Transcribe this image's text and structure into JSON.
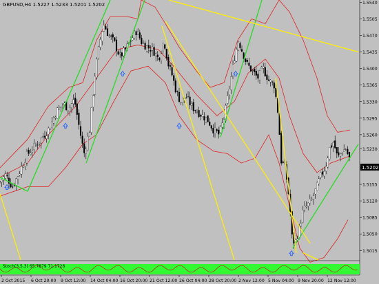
{
  "window": {
    "symbol_info": "GBPUSD,H4  1.5227 1.5233 1.5201 1.5202",
    "indicator_info": "Stoch(3,5,3) 65.7879 71.1726"
  },
  "price_axis": {
    "ticks": [
      "1.5540",
      "1.5505",
      "1.5470",
      "1.5435",
      "1.5400",
      "1.5365",
      "1.5330",
      "1.5295",
      "1.5260",
      "1.5230",
      "1.5190",
      "1.5155",
      "1.5120",
      "1.5085",
      "1.5050",
      "1.5015"
    ],
    "current_price": "1.5202",
    "range": [
      1.4995,
      1.5545
    ]
  },
  "time_axis": {
    "labels": [
      "2 Oct 2015",
      "6 Oct 20:00",
      "9 Oct 12:00",
      "14 Oct 04:00",
      "16 Oct 20:00",
      "21 Oct 12:00",
      "26 Oct 04:00",
      "28 Oct 20:00",
      "2 Nov 12:00",
      "5 Nov 04:00",
      "9 Nov 20:00",
      "12 Nov 12:00"
    ]
  },
  "colors": {
    "background": "#c0c0c0",
    "bull_candle": "#ffffff",
    "bear_candle": "#000000",
    "bollinger": "#e02020",
    "trendline_green": "#22dd22",
    "trendline_yellow": "#ffee00",
    "arrow": "#2060ff",
    "price_marker_bg": "#000000",
    "stoch_band": "#22ff22"
  },
  "icons": [
    "up-arrow-icon"
  ],
  "chart_data": {
    "type": "candlestick",
    "symbol": "GBPUSD",
    "timeframe": "H4",
    "ohlc_last": {
      "open": 1.5227,
      "high": 1.5233,
      "low": 1.5201,
      "close": 1.5202
    },
    "ylim": [
      1.4995,
      1.5545
    ],
    "close_path": [
      [
        0,
        1.516
      ],
      [
        8,
        1.5175
      ],
      [
        18,
        1.515
      ],
      [
        28,
        1.518
      ],
      [
        38,
        1.5215
      ],
      [
        50,
        1.5235
      ],
      [
        62,
        1.5255
      ],
      [
        72,
        1.5275
      ],
      [
        82,
        1.531
      ],
      [
        92,
        1.5325
      ],
      [
        100,
        1.5315
      ],
      [
        108,
        1.5335
      ],
      [
        115,
        1.5275
      ],
      [
        122,
        1.522
      ],
      [
        130,
        1.527
      ],
      [
        138,
        1.539
      ],
      [
        144,
        1.545
      ],
      [
        150,
        1.5495
      ],
      [
        158,
        1.547
      ],
      [
        166,
        1.5455
      ],
      [
        174,
        1.5425
      ],
      [
        182,
        1.544
      ],
      [
        190,
        1.546
      ],
      [
        198,
        1.548
      ],
      [
        206,
        1.5455
      ],
      [
        214,
        1.5445
      ],
      [
        222,
        1.544
      ],
      [
        230,
        1.542
      ],
      [
        238,
        1.546
      ],
      [
        244,
        1.541
      ],
      [
        250,
        1.5385
      ],
      [
        256,
        1.535
      ],
      [
        262,
        1.533
      ],
      [
        270,
        1.534
      ],
      [
        278,
        1.532
      ],
      [
        286,
        1.531
      ],
      [
        294,
        1.53
      ],
      [
        302,
        1.529
      ],
      [
        310,
        1.527
      ],
      [
        318,
        1.526
      ],
      [
        326,
        1.53
      ],
      [
        334,
        1.537
      ],
      [
        340,
        1.542
      ],
      [
        346,
        1.546
      ],
      [
        352,
        1.5435
      ],
      [
        358,
        1.541
      ],
      [
        366,
        1.5395
      ],
      [
        374,
        1.538
      ],
      [
        382,
        1.54
      ],
      [
        390,
        1.5375
      ],
      [
        398,
        1.5365
      ],
      [
        404,
        1.53
      ],
      [
        408,
        1.5205
      ],
      [
        414,
        1.519
      ],
      [
        420,
        1.512
      ],
      [
        424,
        1.504
      ],
      [
        428,
        1.503
      ],
      [
        434,
        1.506
      ],
      [
        440,
        1.51
      ],
      [
        446,
        1.511
      ],
      [
        452,
        1.512
      ],
      [
        460,
        1.515
      ],
      [
        466,
        1.5175
      ],
      [
        472,
        1.519
      ],
      [
        478,
        1.523
      ],
      [
        484,
        1.5245
      ],
      [
        490,
        1.521
      ],
      [
        496,
        1.5225
      ],
      [
        502,
        1.523
      ],
      [
        508,
        1.5205
      ]
    ],
    "bollinger_upper_path": [
      [
        0,
        1.519
      ],
      [
        40,
        1.525
      ],
      [
        70,
        1.532
      ],
      [
        100,
        1.536
      ],
      [
        120,
        1.537
      ],
      [
        140,
        1.546
      ],
      [
        160,
        1.551
      ],
      [
        185,
        1.551
      ],
      [
        200,
        1.5505
      ],
      [
        205,
        1.5545
      ],
      [
        225,
        1.553
      ],
      [
        240,
        1.5495
      ],
      [
        260,
        1.5445
      ],
      [
        285,
        1.5395
      ],
      [
        305,
        1.536
      ],
      [
        325,
        1.537
      ],
      [
        345,
        1.546
      ],
      [
        365,
        1.5505
      ],
      [
        385,
        1.5495
      ],
      [
        405,
        1.5545
      ],
      [
        420,
        1.552
      ],
      [
        440,
        1.546
      ],
      [
        460,
        1.538
      ],
      [
        475,
        1.53
      ],
      [
        490,
        1.5265
      ],
      [
        508,
        1.527
      ]
    ],
    "bollinger_middle_path": [
      [
        0,
        1.517
      ],
      [
        40,
        1.52
      ],
      [
        70,
        1.526
      ],
      [
        110,
        1.532
      ],
      [
        140,
        1.538
      ],
      [
        170,
        1.544
      ],
      [
        200,
        1.545
      ],
      [
        230,
        1.544
      ],
      [
        255,
        1.54
      ],
      [
        285,
        1.5345
      ],
      [
        315,
        1.53
      ],
      [
        340,
        1.533
      ],
      [
        360,
        1.539
      ],
      [
        385,
        1.542
      ],
      [
        405,
        1.538
      ],
      [
        420,
        1.53
      ],
      [
        440,
        1.522
      ],
      [
        460,
        1.518
      ],
      [
        480,
        1.52
      ],
      [
        508,
        1.5215
      ]
    ],
    "bollinger_lower_path": [
      [
        0,
        1.513
      ],
      [
        40,
        1.515
      ],
      [
        70,
        1.515
      ],
      [
        95,
        1.519
      ],
      [
        120,
        1.524
      ],
      [
        140,
        1.526
      ],
      [
        165,
        1.533
      ],
      [
        190,
        1.5395
      ],
      [
        215,
        1.5405
      ],
      [
        240,
        1.537
      ],
      [
        260,
        1.53
      ],
      [
        285,
        1.525
      ],
      [
        310,
        1.5225
      ],
      [
        330,
        1.522
      ],
      [
        350,
        1.52
      ],
      [
        370,
        1.521
      ],
      [
        390,
        1.526
      ],
      [
        405,
        1.52
      ],
      [
        420,
        1.511
      ],
      [
        435,
        1.502
      ],
      [
        450,
        1.499
      ],
      [
        470,
        1.5
      ],
      [
        490,
        1.504
      ],
      [
        505,
        1.508
      ]
    ],
    "trendlines_green": [
      [
        [
          0,
          1.517
        ],
        [
          40,
          1.514
        ]
      ],
      [
        [
          40,
          1.514
        ],
        [
          160,
          1.5545
        ]
      ],
      [
        [
          125,
          1.52
        ],
        [
          210,
          1.5545
        ]
      ],
      [
        [
          320,
          1.5255
        ],
        [
          380,
          1.5545
        ]
      ],
      [
        [
          425,
          1.502
        ],
        [
          520,
          1.524
        ]
      ]
    ],
    "trendlines_yellow": [
      [
        [
          245,
          1.5545
        ],
        [
          520,
          1.5435
        ]
      ],
      [
        [
          235,
          1.549
        ],
        [
          340,
          1.4995
        ]
      ],
      [
        [
          240,
          1.55
        ],
        [
          450,
          1.503
        ]
      ],
      [
        [
          0,
          1.5135
        ],
        [
          30,
          1.4995
        ]
      ],
      [
        [
          400,
          1.538
        ],
        [
          430,
          1.501
        ]
      ],
      [
        [
          440,
          1.501
        ],
        [
          462,
          1.4995
        ]
      ]
    ],
    "arrows_up": [
      [
        10,
        1.516
      ],
      [
        95,
        1.529
      ],
      [
        178,
        1.54
      ],
      [
        260,
        1.529
      ],
      [
        342,
        1.54
      ],
      [
        423,
        1.502
      ]
    ],
    "stochastic": {
      "k": 65.7879,
      "d": 71.1726,
      "params": "3,5,3"
    }
  }
}
